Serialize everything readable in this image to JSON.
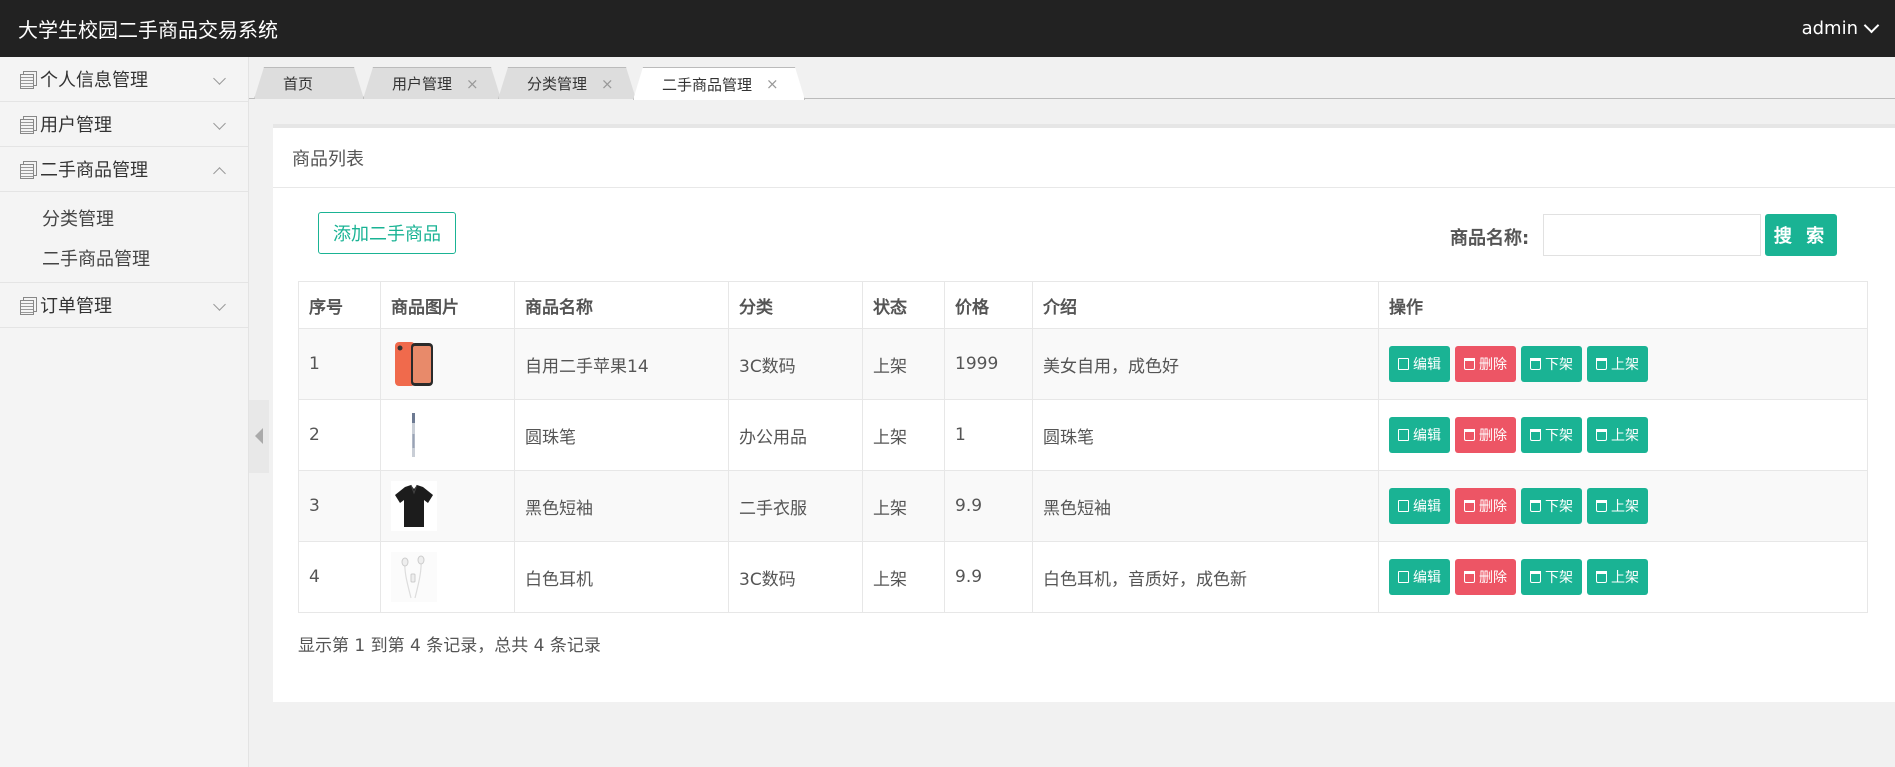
{
  "header": {
    "title": "大学生校园二手商品交易系统",
    "user": "admin"
  },
  "sidebar": {
    "items": [
      {
        "label": "个人信息管理"
      },
      {
        "label": "用户管理"
      },
      {
        "label": "二手商品管理"
      },
      {
        "label": "订单管理"
      }
    ],
    "submenu": [
      {
        "label": "分类管理"
      },
      {
        "label": "二手商品管理"
      }
    ]
  },
  "tabs": [
    {
      "label": "首页"
    },
    {
      "label": "用户管理",
      "close": "×"
    },
    {
      "label": "分类管理",
      "close": "×"
    },
    {
      "label": "二手商品管理",
      "close": "×"
    }
  ],
  "panel": {
    "title": "商品列表",
    "add_label": "添加二手商品",
    "search_label": "商品名称:",
    "search_value": "",
    "search_button": "搜 索"
  },
  "table": {
    "headers": [
      "序号",
      "商品图片",
      "商品名称",
      "分类",
      "状态",
      "价格",
      "介绍",
      "操作"
    ],
    "rows": [
      {
        "id": "1",
        "image": "phone-image",
        "name": "自用二手苹果14",
        "category": "3C数码",
        "status": "上架",
        "price": "1999",
        "intro": "美女自用，成色好"
      },
      {
        "id": "2",
        "image": "pen-image",
        "name": "圆珠笔",
        "category": "办公用品",
        "status": "上架",
        "price": "1",
        "intro": "圆珠笔"
      },
      {
        "id": "3",
        "image": "shirt-image",
        "name": "黑色短袖",
        "category": "二手衣服",
        "status": "上架",
        "price": "9.9",
        "intro": "黑色短袖"
      },
      {
        "id": "4",
        "image": "earphone-image",
        "name": "白色耳机",
        "category": "3C数码",
        "status": "上架",
        "price": "9.9",
        "intro": "白色耳机，音质好，成色新"
      }
    ],
    "actions": {
      "edit": "编辑",
      "delete": "删除",
      "off": "下架",
      "on": "上架"
    }
  },
  "footer": {
    "info": "显示第 1 到第 4 条记录，总共 4 条记录"
  },
  "colors": {
    "topbar": "#222222",
    "primary": "#1ab394",
    "danger": "#ed5565"
  }
}
